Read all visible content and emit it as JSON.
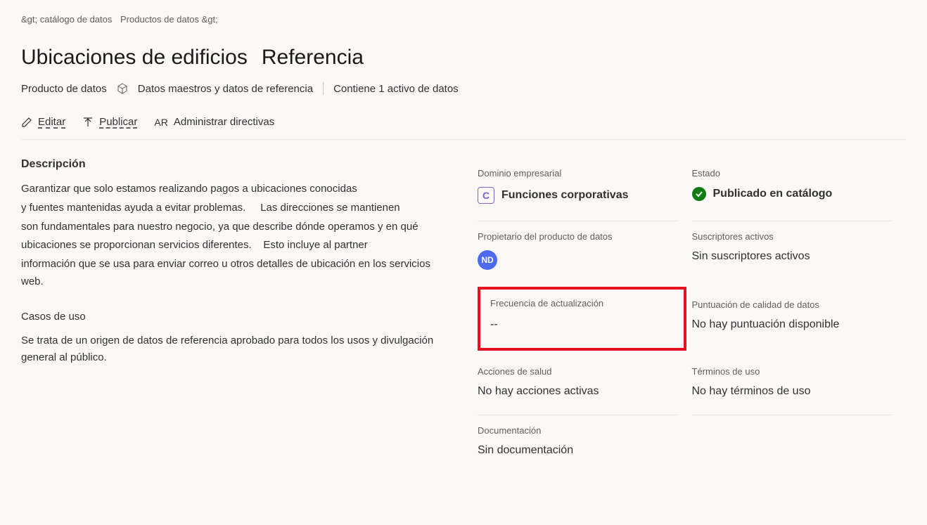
{
  "breadcrumb": {
    "part1": "&gt; catálogo de datos",
    "part2": "Productos de datos &gt;"
  },
  "header": {
    "title": "Ubicaciones de edificios",
    "subtitle": "Referencia",
    "type_label": "Producto de datos",
    "category": "Datos maestros y datos de referencia",
    "asset_count": "Contiene 1 activo de datos"
  },
  "actions": {
    "edit": "Editar",
    "publish": "Publicar",
    "ar_badge": "AR",
    "manage_policies": "Administrar directivas"
  },
  "description": {
    "label": "Descripción",
    "line1": "Garantizar que solo estamos realizando pagos a ubicaciones conocidas",
    "line2a": "y fuentes mantenidas ayuda a evitar problemas.",
    "line2b": "Las direcciones se mantienen",
    "line3": "son fundamentales para nuestro negocio, ya que describe dónde operamos y en qué",
    "line4a": "ubicaciones se proporcionan servicios diferentes.",
    "line4b": "Esto incluye al partner",
    "line5": "información que se usa para enviar correo u otros detalles de ubicación en los servicios web."
  },
  "use_cases": {
    "label": "Casos de uso",
    "text": "Se trata de un origen de datos de referencia aprobado para todos los usos y divulgación general al público."
  },
  "info": {
    "domain": {
      "label": "Dominio empresarial",
      "badge": "C",
      "value": "Funciones corporativas"
    },
    "status": {
      "label": "Estado",
      "value": "Publicado en catálogo"
    },
    "owner": {
      "label": "Propietario del producto de datos",
      "initials": "ND"
    },
    "subscribers": {
      "label": "Suscriptores activos",
      "value": "Sin suscriptores activos"
    },
    "update_freq": {
      "label": "Frecuencia de actualización",
      "value": "--"
    },
    "quality": {
      "label": "Puntuación de calidad de datos",
      "value": "No hay puntuación disponible"
    },
    "health": {
      "label": "Acciones de salud",
      "value": "No hay acciones activas"
    },
    "terms": {
      "label": "Términos de uso",
      "value": "No hay términos de uso"
    },
    "docs": {
      "label": "Documentación",
      "value": "Sin documentación"
    }
  }
}
